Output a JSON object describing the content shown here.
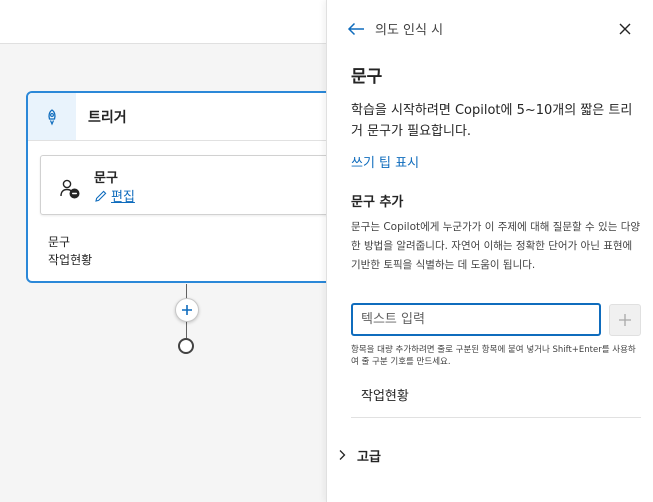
{
  "canvas": {
    "trigger_card": {
      "title": "트리거",
      "phrase_box": {
        "title": "문구",
        "edit_label": "편집"
      },
      "field_label": "문구",
      "field_value": "작업현황"
    }
  },
  "panel": {
    "breadcrumb": "의도 인식 시",
    "heading": "문구",
    "description": "학습을 시작하려면 Copilot에 5~10개의 짧은 트리거 문구가 필요합니다.",
    "tips_link": "쓰기 팁 표시",
    "add_section": {
      "title": "문구 추가",
      "description": "문구는 Copilot에게 누군가가 이 주제에 대해 질문할 수 있는 다양한 방법을 알려줍니다. 자연어 이해는 정확한 단어가 아닌 표현에 기반한 토픽을 식별하는 데 도움이 됩니다.",
      "input_placeholder": "텍스트 입력",
      "bulk_hint": "항목을 대량 추가하려면 줄로 구분된 항목에 붙여 넣거나 Shift+Enter를 사용하여 줄 구분 기호를 만드세요."
    },
    "phrases": [
      "작업현황"
    ],
    "advanced_label": "고급"
  },
  "colors": {
    "accent": "#0f6cbd",
    "card_border": "#2b88d8"
  },
  "icons": [
    "rocket-icon",
    "person-chat-icon",
    "pencil-icon",
    "plus-icon",
    "back-arrow-icon",
    "close-icon",
    "chevron-right-icon"
  ]
}
